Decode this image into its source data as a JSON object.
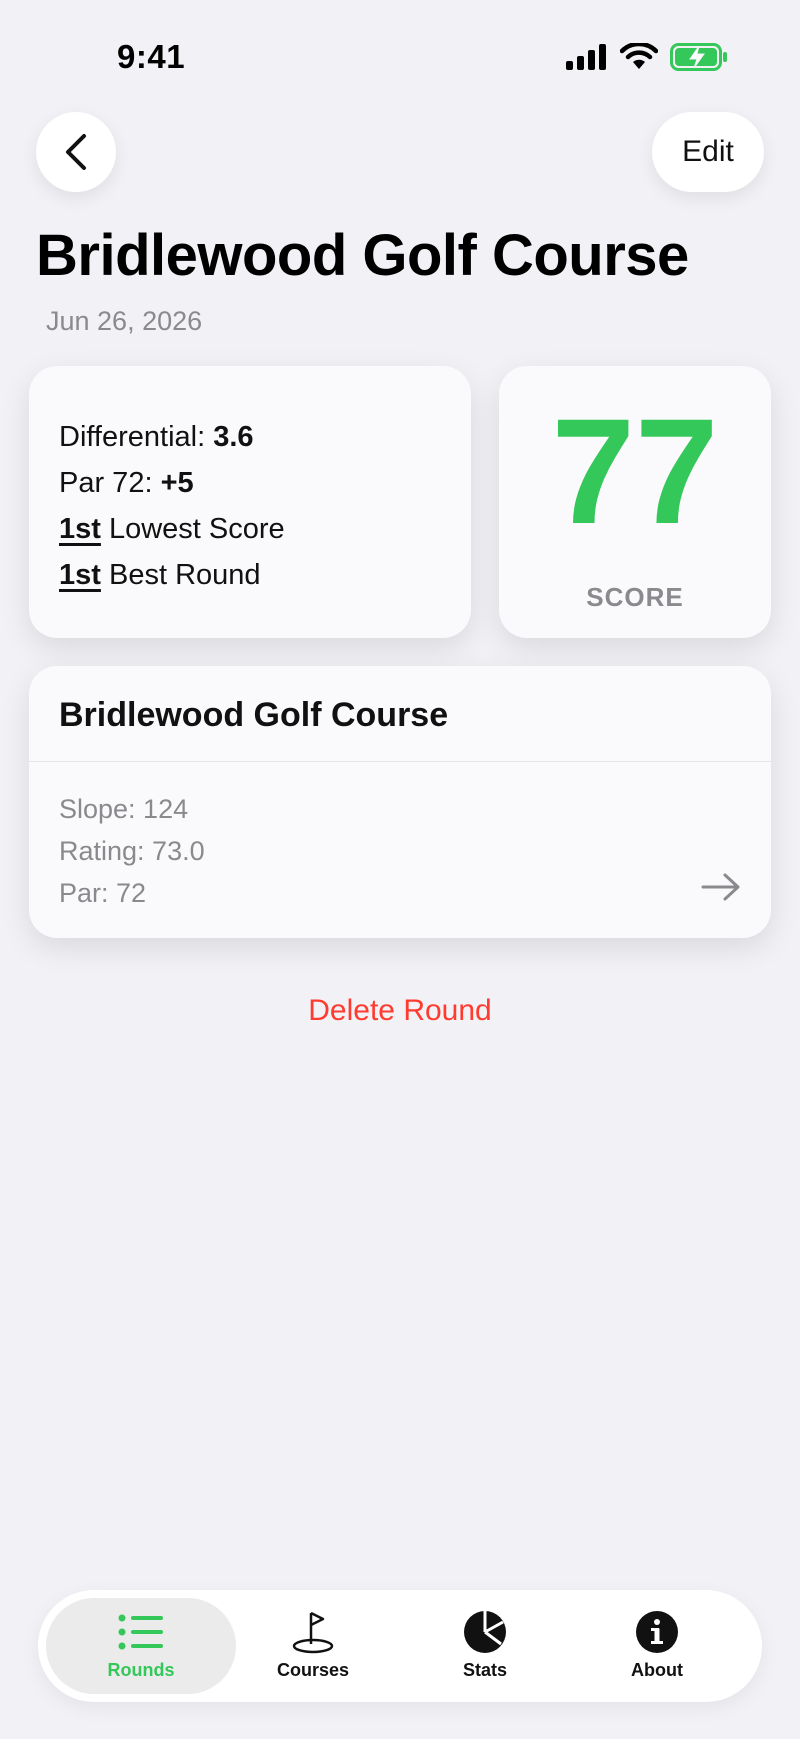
{
  "status_bar": {
    "time": "9:41"
  },
  "nav": {
    "edit_label": "Edit"
  },
  "page": {
    "title": "Bridlewood Golf Course",
    "date": "Jun 26, 2026"
  },
  "stats": {
    "differential_label": "Differential: ",
    "differential_value": "3.6",
    "par_label": "Par 72: ",
    "par_value": "+5",
    "lowest_rank": "1st",
    "lowest_text": " Lowest Score",
    "best_rank": "1st",
    "best_text": " Best Round"
  },
  "score": {
    "value": "77",
    "label": "SCORE",
    "color": "#34c759"
  },
  "course": {
    "name": "Bridlewood Golf Course",
    "slope": "Slope: 124",
    "rating": "Rating: 73.0",
    "par": "Par: 72"
  },
  "actions": {
    "delete_label": "Delete Round",
    "delete_color": "#ff3b30"
  },
  "tab_bar": {
    "tabs": [
      {
        "label": "Rounds",
        "icon": "list-icon",
        "active": true
      },
      {
        "label": "Courses",
        "icon": "flag-icon",
        "active": false
      },
      {
        "label": "Stats",
        "icon": "pie-chart-icon",
        "active": false
      },
      {
        "label": "About",
        "icon": "info-icon",
        "active": false
      }
    ]
  }
}
